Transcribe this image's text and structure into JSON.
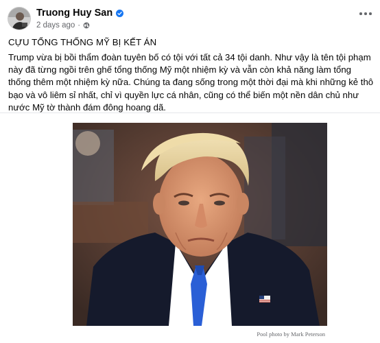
{
  "post": {
    "author": "Truong Huy San",
    "timestamp": "2 days ago",
    "separator": "·",
    "headline": "CỰU TỔNG THỐNG MỸ BỊ KẾT ÁN",
    "body": "Trump vừa bị bồi thẩm đoàn tuyên bố có tội với tất cả 34 tội danh. Như vậy là tên tội phạm này đã từng ngồi trên ghế tổng thống Mỹ một nhiệm kỳ và vẫn còn khả năng làm tổng thống thêm một nhiệm kỳ nữa. Chúng ta đang sống trong một thời đại mà khi những kẻ thô bạo và vô liêm sỉ nhất, chỉ vì quyền lực cá nhân, cũng có thể biến một nền dân chủ như nước Mỹ tờ thành đám đông hoang dã.",
    "photo_caption": "Pool photo by Mark Peterson"
  },
  "icons": {
    "verified": "verified-badge-icon",
    "audience": "globe-icon",
    "more": "more-options-icon"
  },
  "colors": {
    "accent": "#1877f2",
    "secondary_text": "#65676b",
    "primary_text": "#050505"
  }
}
